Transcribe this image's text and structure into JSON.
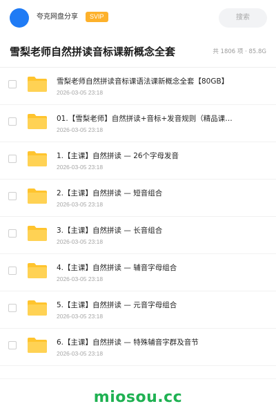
{
  "header": {
    "share_name": "夸克网盘分享",
    "vip_label": "SVIP",
    "search_label": "搜索"
  },
  "folder": {
    "title": "雪梨老师自然拼读音标课新概念全套",
    "meta": "共 1806 项 · 85.8G"
  },
  "files": [
    {
      "name": "雪梨老师自然拼读音标课语法课新概念全套【80GB】",
      "date": "2026-03-05 23:18",
      "icon": "folder-icon"
    },
    {
      "name": "01.【雪梨老师】自然拼读+音标+发音规则（精品课…",
      "date": "2026-03-05 23:18",
      "icon": "folder-icon"
    },
    {
      "name": "1.【主课】自然拼读 — 26个字母发音",
      "date": "2026-03-05 23:18",
      "icon": "folder-icon"
    },
    {
      "name": "2.【主课】自然拼读 — 短音组合",
      "date": "2026-03-05 23:18",
      "icon": "folder-icon"
    },
    {
      "name": "3.【主课】自然拼读 — 长音组合",
      "date": "2026-03-05 23:18",
      "icon": "folder-icon"
    },
    {
      "name": "4.【主课】自然拼读 — 辅音字母组合",
      "date": "2026-03-05 23:18",
      "icon": "folder-icon"
    },
    {
      "name": "5.【主课】自然拼读 — 元音字母组合",
      "date": "2026-03-05 23:18",
      "icon": "folder-icon"
    },
    {
      "name": "6.【主课】自然拼读 — 特殊辅音字群及音节",
      "date": "2026-03-05 23:18",
      "icon": "folder-icon"
    }
  ],
  "watermark": "miosou.cc",
  "colors": {
    "accent_blue": "#1f7bf5",
    "vip_orange": "#fdb12b",
    "folder_yellow": "#ffc42e",
    "watermark_green": "#1fb152"
  }
}
